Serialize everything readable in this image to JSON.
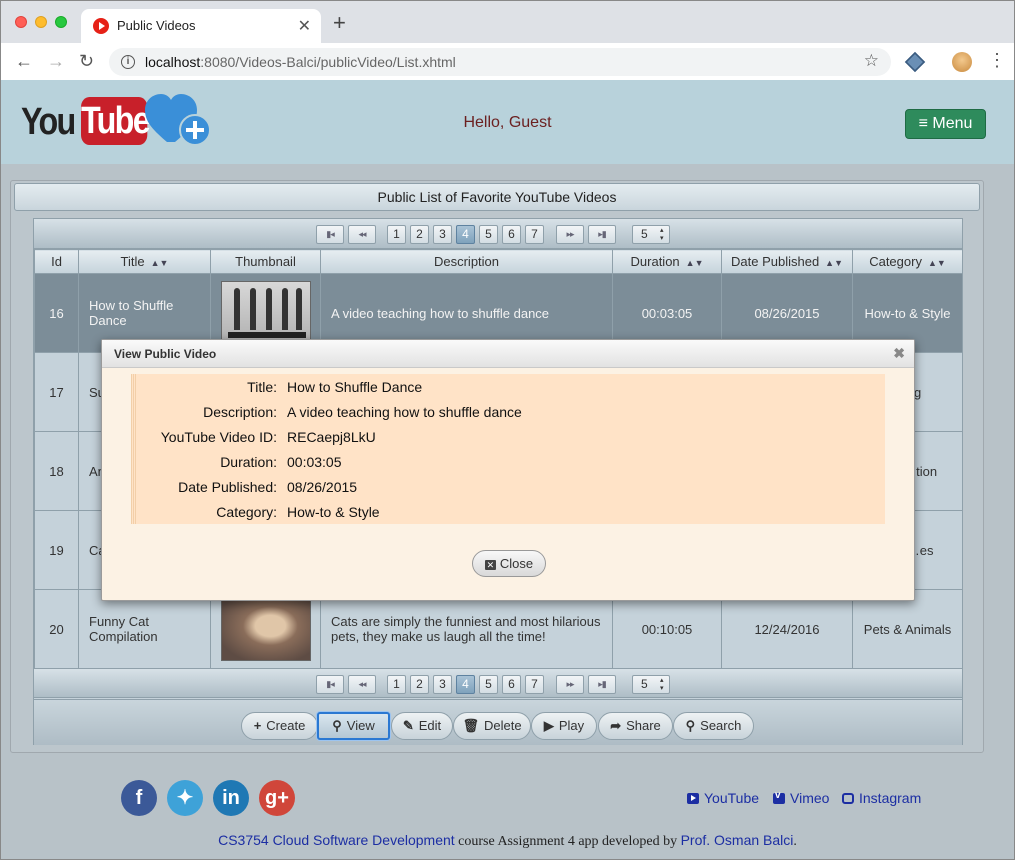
{
  "browser": {
    "tab_title": "Public Videos",
    "url_host": "localhost",
    "url_rest": ":8080/Videos-Balci/publicVideo/List.xhtml"
  },
  "header": {
    "logo_you": "You",
    "logo_tube": "Tube",
    "greeting": "Hello, Guest",
    "menu_label": "≡ Menu"
  },
  "panel": {
    "title": "Public List of Favorite YouTube Videos"
  },
  "paginator": {
    "first": "▮◂",
    "prev": "◂◂",
    "pages": [
      "1",
      "2",
      "3",
      "4",
      "5",
      "6",
      "7"
    ],
    "active_page": "4",
    "next": "▸▸",
    "last": "▸▮",
    "rows_per_page": "5"
  },
  "table": {
    "columns": [
      "Id",
      "Title",
      "Thumbnail",
      "Description",
      "Duration",
      "Date Published",
      "Category"
    ],
    "rows": [
      {
        "id": "16",
        "title": "How to Shuffle Dance",
        "description": "A video teaching how to shuffle dance",
        "duration": "00:03:05",
        "date": "08/26/2015",
        "category": "How-to & Style"
      },
      {
        "id": "17",
        "title": "Su… Oc…",
        "description": "",
        "duration": "",
        "date": "",
        "category": "…ng"
      },
      {
        "id": "18",
        "title": "An…",
        "description": "",
        "duration": "",
        "date": "",
        "category": "…& …tion"
      },
      {
        "id": "19",
        "title": "Ca…",
        "description": "",
        "duration": "",
        "date": "",
        "category": "…& …es"
      },
      {
        "id": "20",
        "title": "Funny Cat Compilation",
        "description": "Cats are simply the funniest and most hilarious pets, they make us laugh all the time!",
        "duration": "00:10:05",
        "date": "12/24/2016",
        "category": "Pets & Animals"
      }
    ]
  },
  "actions": {
    "create": "Create",
    "view": "View",
    "edit": "Edit",
    "delete": "Delete",
    "play": "Play",
    "share": "Share",
    "search": "Search"
  },
  "footer": {
    "youtube": "YouTube",
    "vimeo": "Vimeo",
    "instagram": "Instagram",
    "credit_course": "CS3754 Cloud Software Development",
    "credit_middle": " course Assignment 4 app developed by ",
    "credit_author": "Prof. Osman Balci",
    "credit_end": "."
  },
  "dialog": {
    "title": "View Public Video",
    "fields": [
      {
        "label": "Title:",
        "value": "How to Shuffle Dance"
      },
      {
        "label": "Description:",
        "value": "A video teaching how to shuffle dance"
      },
      {
        "label": "YouTube Video ID:",
        "value": "RECaepj8LkU"
      },
      {
        "label": "Duration:",
        "value": "00:03:05"
      },
      {
        "label": "Date Published:",
        "value": "08/26/2015"
      },
      {
        "label": "Category:",
        "value": "How-to & Style"
      }
    ],
    "close_label": "Close"
  }
}
